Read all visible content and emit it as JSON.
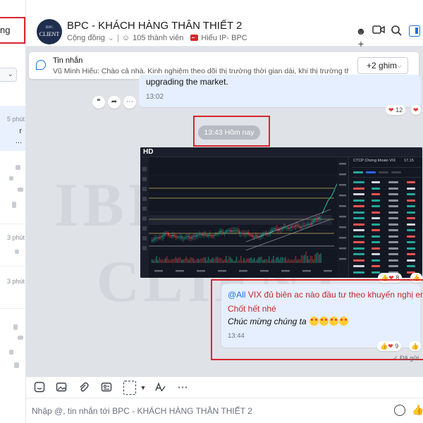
{
  "sidebar": {
    "search_value": "ng",
    "items": [
      {
        "time": "5 phút",
        "snippet_a": "r",
        "snippet_b": "..."
      },
      {
        "time": "3 phút"
      },
      {
        "time": "3 phút"
      }
    ]
  },
  "header": {
    "avatar_text": "CLIENT",
    "title": "BPC - KHÁCH HÀNG THÂN THIẾT 2",
    "community_label": "Cộng đồng",
    "members": "105 thành viên",
    "tag_label": "Hiểu IP- BPC"
  },
  "pinned": {
    "title": "Tin nhắn",
    "text": "Vũ Minh Hiếu: Chào cả nhà. Kinh nghiệm theo dõi thị trường thời gian dài, khi thị trường thuận l...",
    "more_label": "+2 ghim"
  },
  "watermark": {
    "text_a": "IBPC",
    "text_b": "CLIENT"
  },
  "messages": [
    {
      "text": "upgrading the market.",
      "time": "13:02",
      "reaction_count": "12"
    },
    {
      "type": "divider",
      "text": "13:43 Hôm nay"
    },
    {
      "type": "image",
      "reaction_count": "8",
      "chart": {
        "label": "HD",
        "symbol": "VIX",
        "side_title": "CTCP Chứng khoán VIX",
        "price": "17,15"
      }
    },
    {
      "mention": "@All",
      "line1": " VIX đủ biên ac nào đầu tư theo khuyến nghị em",
      "line2": "Chốt hết nhé",
      "line3": "Chúc mừng chúng ta",
      "time": "13:44",
      "reaction_count": "9"
    }
  ],
  "seen_label": "Đã gửi",
  "composer": {
    "placeholder": "Nhập @, tin nhắn tới BPC - KHÁCH HÀNG THÂN THIẾT 2"
  },
  "colors": {
    "accent": "#1a73e8",
    "highlight": "#d9262c",
    "bubble": "#e5efff",
    "chat_bg": "#dfe2e7"
  },
  "icons": [
    "add-member-icon",
    "video-call-icon",
    "search-icon",
    "panel-toggle-icon",
    "sticker-icon",
    "image-icon",
    "attach-icon",
    "contact-card-icon",
    "screenshot-icon",
    "format-text-icon",
    "more-icon",
    "emoji-icon",
    "like-icon"
  ]
}
